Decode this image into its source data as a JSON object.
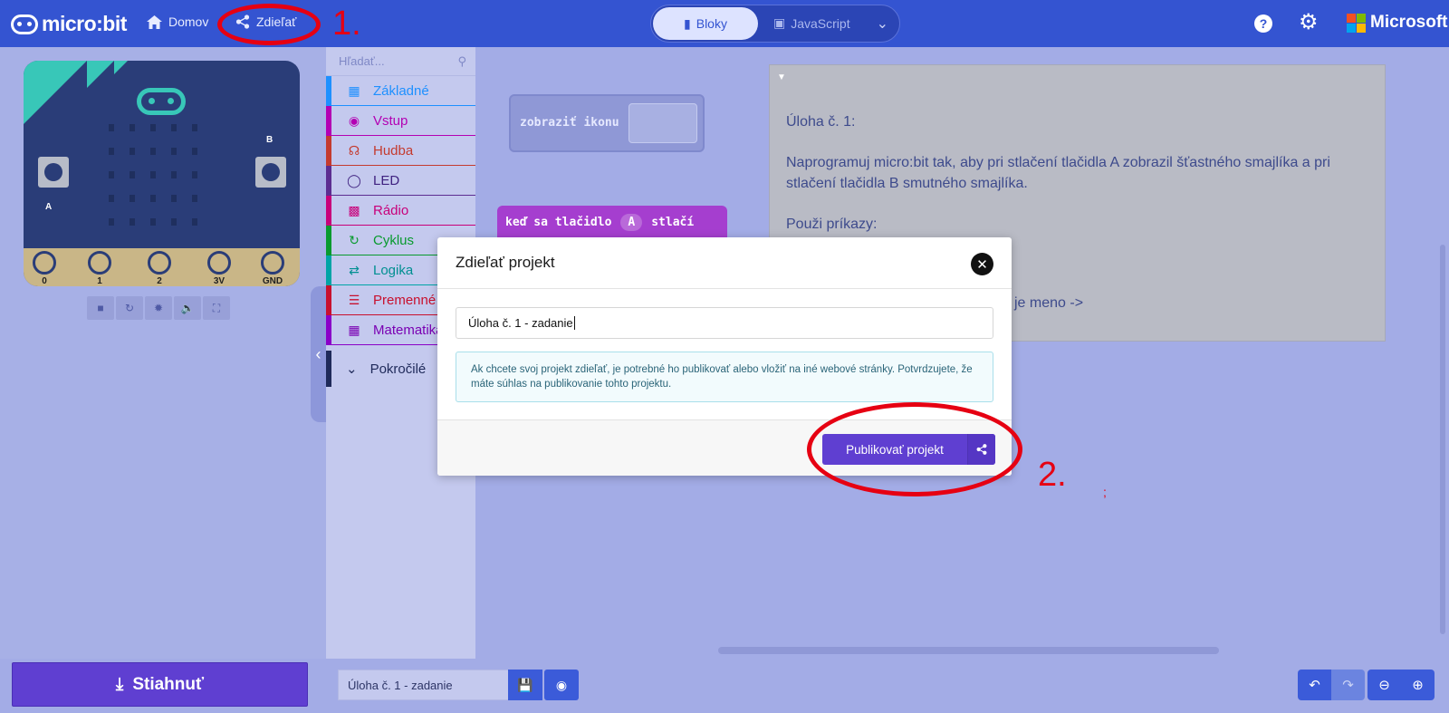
{
  "header": {
    "logo_text": "micro:bit",
    "home_label": "Domov",
    "share_label": "Zdieľať",
    "blocks_label": "Bloky",
    "javascript_label": "JavaScript",
    "help_symbol": "?",
    "brand_label": "Microsoft",
    "accent_color": "#3454d1"
  },
  "annotations": {
    "step1": "1.",
    "step2": "2.",
    "stray_mark": ";",
    "color": "#e60012"
  },
  "simulator": {
    "button_a": "A",
    "button_b": "B",
    "pins": [
      "0",
      "1",
      "2",
      "3V",
      "GND"
    ],
    "controls": [
      "stop-icon",
      "restart-icon",
      "debug-icon",
      "sound-icon",
      "fullscreen-icon"
    ]
  },
  "toolbox": {
    "search_placeholder": "Hľadať...",
    "categories": [
      {
        "label": "Základné",
        "color": "#1e90ff",
        "icon": "grid-icon"
      },
      {
        "label": "Vstup",
        "color": "#d400d4",
        "icon": "target-icon"
      },
      {
        "label": "Hudba",
        "color": "#e63022",
        "icon": "headphones-icon"
      },
      {
        "label": "LED",
        "color": "#5c2d91",
        "icon": "toggle-icon"
      },
      {
        "label": "Rádio",
        "color": "#e3008c",
        "icon": "signal-icon"
      },
      {
        "label": "Cyklus",
        "color": "#00aa00",
        "icon": "refresh-icon"
      },
      {
        "label": "Logika",
        "color": "#00a4a6",
        "icon": "shuffle-icon"
      },
      {
        "label": "Premenné",
        "color": "#dc143c",
        "icon": "lines-icon"
      },
      {
        "label": "Matematika",
        "color": "#9400d3",
        "icon": "calculator-icon"
      }
    ],
    "advanced_label": "Pokročilé"
  },
  "workspace": {
    "show_icon_block": "zobraziť ikonu",
    "on_button_block": {
      "prefix": "keď sa tlačidlo",
      "value": "A",
      "suffix": "stlačí"
    },
    "comment_text": "Úloha č. 1:\n\nNaprogramuj micro:bit tak, aby pri stlačení tlačidla A zobrazil šťastného smajlíka a pri stlačení tlačidla B smutného smajlíka.\n\nPouži príkazy:",
    "comment_fragment": "je meno ->"
  },
  "modal": {
    "title": "Zdieľať projekt",
    "project_name_value": "Úloha č. 1 - zadanie",
    "info_text": "Ak chcete svoj projekt zdieľať, je potrebné ho publikovať alebo vložiť na iné webové stránky. Potvrdzujete, že máte súhlas na publikovanie tohto projektu.",
    "publish_label": "Publikovať projekt"
  },
  "footer": {
    "download_label": "Stiahnuť",
    "project_name": "Úloha č. 1 - zadanie",
    "download_color": "#5f3fd1"
  }
}
